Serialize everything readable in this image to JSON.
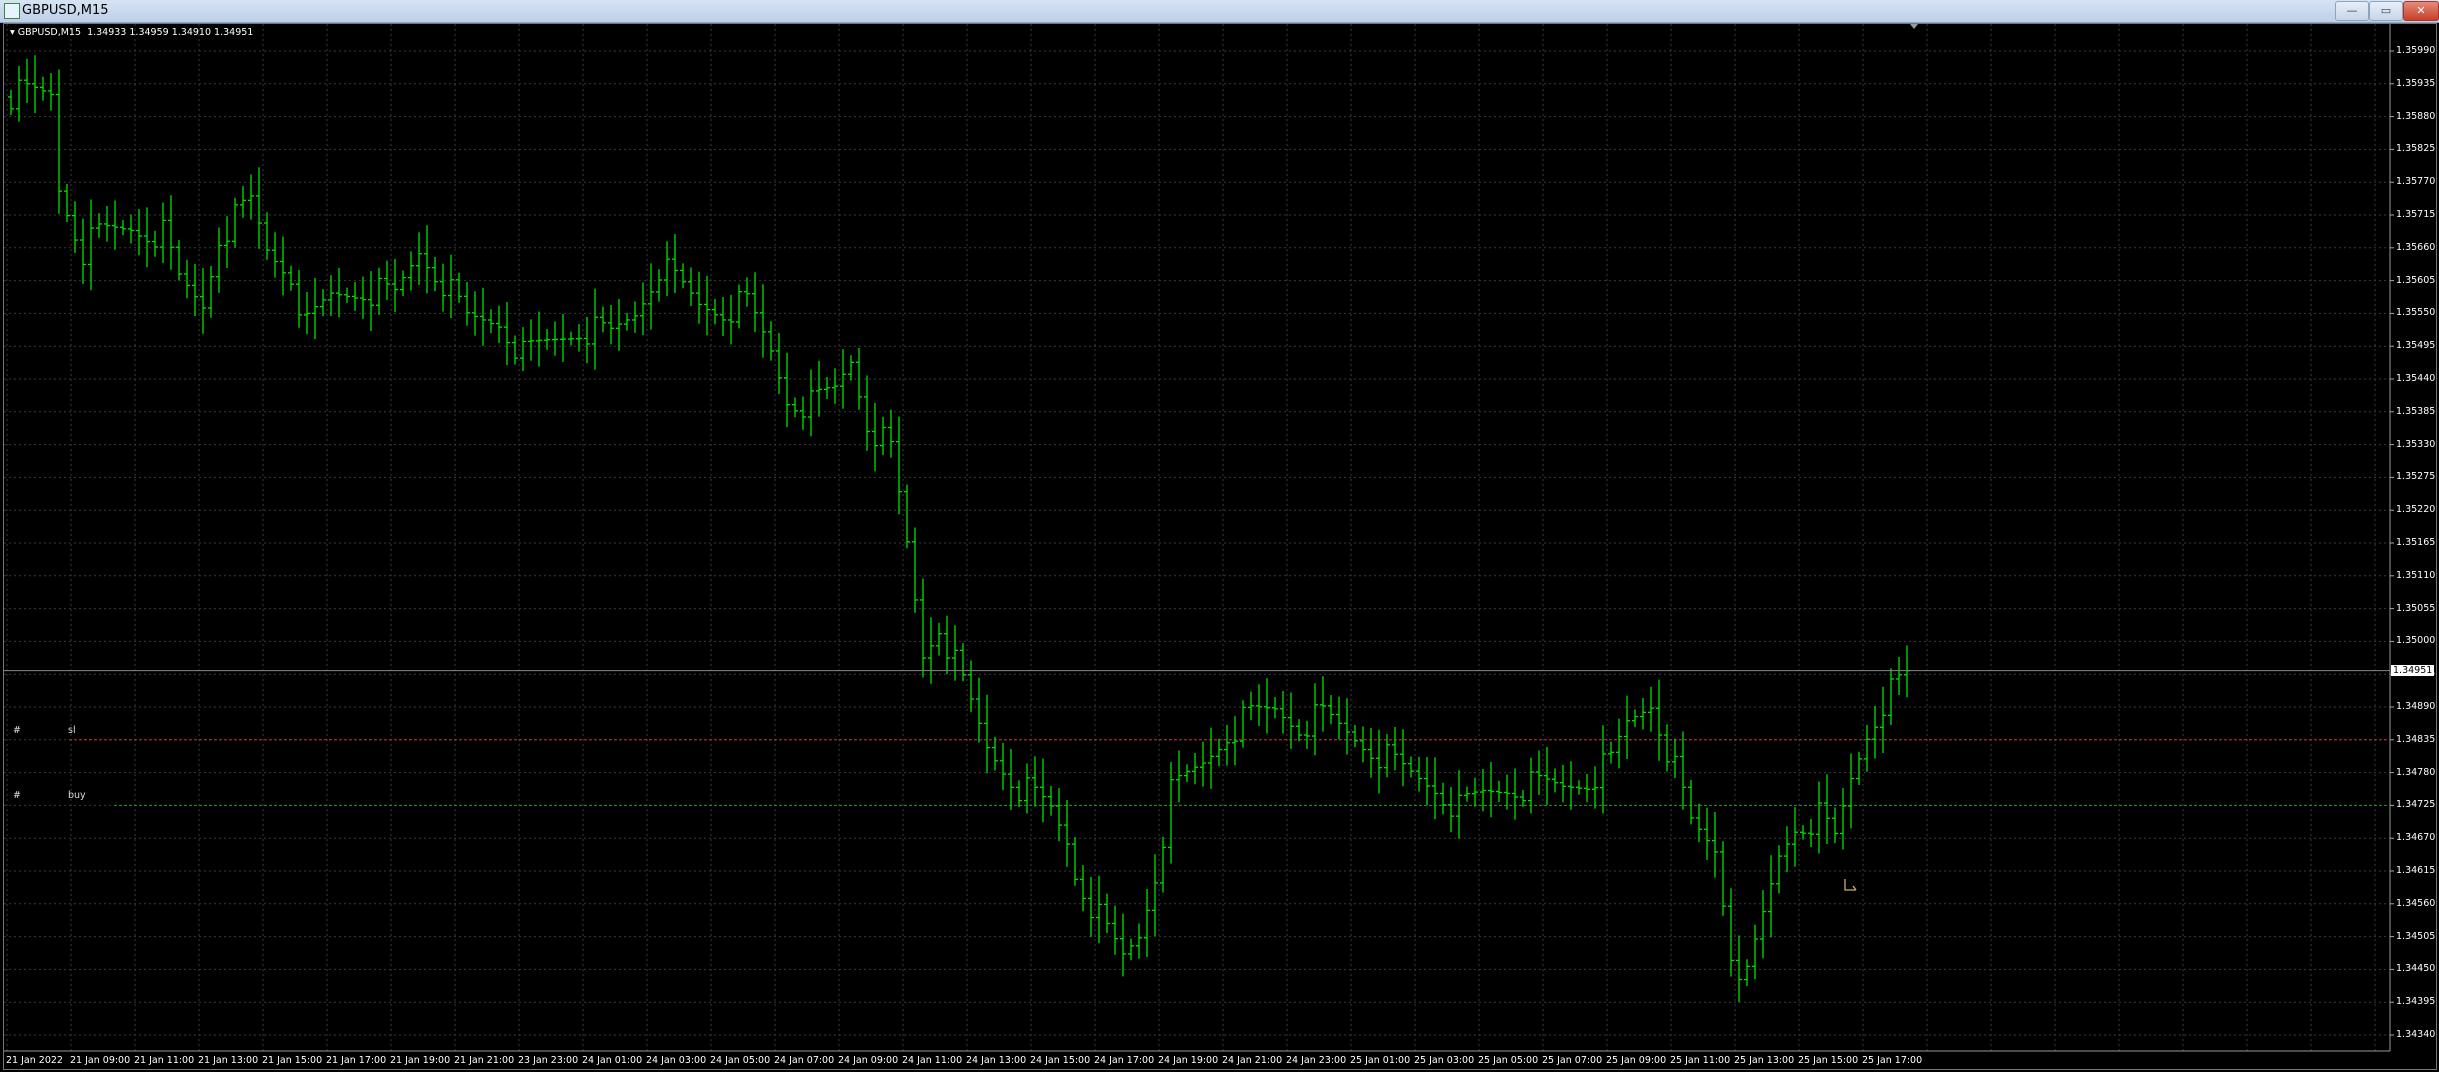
{
  "window": {
    "title": "GBPUSD,M15",
    "min_label": "—",
    "max_label": "▭",
    "close_label": "✕"
  },
  "info": {
    "symbol": "GBPUSD,M15",
    "open": "1.34933",
    "high": "1.34959",
    "low": "1.34910",
    "close": "1.34951"
  },
  "objects": [
    {
      "hash": "#",
      "name": "sl",
      "price": 1.34835,
      "color": "#c03030"
    },
    {
      "hash": "#",
      "name": "buy",
      "price": 1.34725,
      "color": "#2f8f2f"
    }
  ],
  "current_price": "1.34951",
  "colors": {
    "bars": "#00e000",
    "grid": "#3a3a3a",
    "background": "#000000"
  },
  "chart_data": {
    "type": "ohlc",
    "title": "GBPUSD,M15",
    "ylim": [
      1.3431,
      1.3602
    ],
    "y_ticks": [
      "1.35990",
      "1.35935",
      "1.35880",
      "1.35825",
      "1.35770",
      "1.35715",
      "1.35660",
      "1.35605",
      "1.35550",
      "1.35495",
      "1.35440",
      "1.35385",
      "1.35330",
      "1.35275",
      "1.35220",
      "1.35165",
      "1.35110",
      "1.35055",
      "1.35000",
      "1.34945",
      "1.34890",
      "1.34835",
      "1.34780",
      "1.34725",
      "1.34670",
      "1.34615",
      "1.34560",
      "1.34505",
      "1.34450",
      "1.34395",
      "1.34340"
    ],
    "x_labels": [
      "21 Jan 2022",
      "21 Jan 09:00",
      "21 Jan 11:00",
      "21 Jan 13:00",
      "21 Jan 15:00",
      "21 Jan 17:00",
      "21 Jan 19:00",
      "21 Jan 21:00",
      "23 Jan 23:00",
      "24 Jan 01:00",
      "24 Jan 03:00",
      "24 Jan 05:00",
      "24 Jan 07:00",
      "24 Jan 09:00",
      "24 Jan 11:00",
      "24 Jan 13:00",
      "24 Jan 15:00",
      "24 Jan 17:00",
      "24 Jan 19:00",
      "24 Jan 21:00",
      "24 Jan 23:00",
      "25 Jan 01:00",
      "25 Jan 03:00",
      "25 Jan 05:00",
      "25 Jan 07:00",
      "25 Jan 09:00",
      "25 Jan 11:00",
      "25 Jan 13:00",
      "25 Jan 15:00",
      "25 Jan 17:00"
    ],
    "bars_per_label": 8,
    "bar_count": 238,
    "close_path": [
      [
        0,
        1.35917
      ],
      [
        5,
        1.35917
      ],
      [
        6,
        1.35761
      ],
      [
        9,
        1.35656
      ],
      [
        11,
        1.35682
      ],
      [
        15,
        1.35695
      ],
      [
        19,
        1.35682
      ],
      [
        21,
        1.35604
      ],
      [
        24,
        1.35565
      ],
      [
        26,
        1.35682
      ],
      [
        28,
        1.35708
      ],
      [
        30,
        1.35735
      ],
      [
        32,
        1.35656
      ],
      [
        35,
        1.35617
      ],
      [
        37,
        1.35526
      ],
      [
        40,
        1.35578
      ],
      [
        44,
        1.35591
      ],
      [
        48,
        1.35578
      ],
      [
        51,
        1.35656
      ],
      [
        54,
        1.35604
      ],
      [
        57,
        1.35539
      ],
      [
        61,
        1.35539
      ],
      [
        64,
        1.35479
      ],
      [
        67,
        1.355
      ],
      [
        71,
        1.35526
      ],
      [
        75,
        1.35513
      ],
      [
        78,
        1.35552
      ],
      [
        81,
        1.3563
      ],
      [
        83,
        1.35604
      ],
      [
        86,
        1.35565
      ],
      [
        89,
        1.35557
      ],
      [
        92,
        1.35565
      ],
      [
        95,
        1.35487
      ],
      [
        97,
        1.35409
      ],
      [
        100,
        1.35396
      ],
      [
        103,
        1.35422
      ],
      [
        105,
        1.35474
      ],
      [
        107,
        1.3537
      ],
      [
        110,
        1.35317
      ],
      [
        112,
        1.35161
      ],
      [
        114,
        1.34978
      ],
      [
        116,
        1.35031
      ],
      [
        119,
        1.34926
      ],
      [
        122,
        1.34822
      ],
      [
        126,
        1.34757
      ],
      [
        130,
        1.34718
      ],
      [
        132,
        1.34666
      ],
      [
        133,
        1.34613
      ],
      [
        135,
        1.34561
      ],
      [
        137,
        1.34509
      ],
      [
        139,
        1.3447
      ],
      [
        141,
        1.34509
      ],
      [
        143,
        1.34613
      ],
      [
        145,
        1.34744
      ],
      [
        147,
        1.3477
      ],
      [
        149,
        1.34796
      ],
      [
        152,
        1.34848
      ],
      [
        155,
        1.34874
      ],
      [
        158,
        1.34887
      ],
      [
        161,
        1.34861
      ],
      [
        164,
        1.34874
      ],
      [
        167,
        1.34848
      ],
      [
        170,
        1.34822
      ],
      [
        174,
        1.34783
      ],
      [
        178,
        1.34757
      ],
      [
        181,
        1.34718
      ],
      [
        184,
        1.34744
      ],
      [
        187,
        1.34757
      ],
      [
        191,
        1.34757
      ],
      [
        194,
        1.34757
      ],
      [
        197,
        1.3477
      ],
      [
        200,
        1.34796
      ],
      [
        202,
        1.34861
      ],
      [
        205,
        1.349
      ],
      [
        208,
        1.34783
      ],
      [
        210,
        1.34692
      ],
      [
        213,
        1.34653
      ],
      [
        215,
        1.34483
      ],
      [
        217,
        1.34431
      ],
      [
        219,
        1.34535
      ],
      [
        221,
        1.3464
      ],
      [
        223,
        1.34692
      ],
      [
        226,
        1.34705
      ],
      [
        228,
        1.34666
      ],
      [
        230,
        1.3477
      ],
      [
        232,
        1.34848
      ],
      [
        234,
        1.349
      ],
      [
        236,
        1.34926
      ],
      [
        237,
        1.34951
      ]
    ]
  }
}
